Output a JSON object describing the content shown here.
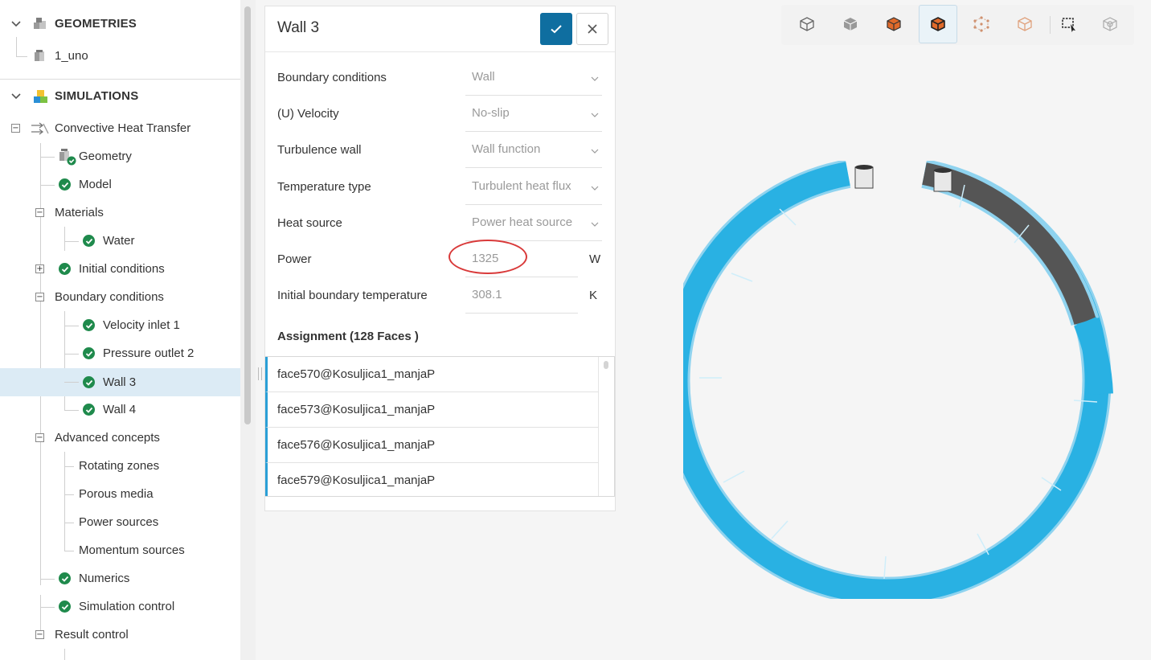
{
  "sidebar": {
    "geometries": {
      "label": "GEOMETRIES",
      "items": [
        {
          "label": "1_uno"
        }
      ]
    },
    "simulations": {
      "label": "SIMULATIONS",
      "simulation": {
        "label": "Convective Heat Transfer"
      },
      "items": {
        "geometry": "Geometry",
        "model": "Model",
        "materials": "Materials",
        "water": "Water",
        "initial_conditions": "Initial conditions",
        "boundary_conditions": "Boundary conditions",
        "velocity_inlet": "Velocity inlet 1",
        "pressure_outlet": "Pressure outlet 2",
        "wall3": "Wall 3",
        "wall4": "Wall 4",
        "advanced_concepts": "Advanced concepts",
        "rotating_zones": "Rotating zones",
        "porous_media": "Porous media",
        "power_sources": "Power sources",
        "momentum_sources": "Momentum sources",
        "numerics": "Numerics",
        "simulation_control": "Simulation control",
        "result_control": "Result control"
      }
    }
  },
  "panel": {
    "title": "Wall 3",
    "fields": [
      {
        "label": "Boundary conditions",
        "value": "Wall"
      },
      {
        "label": "(U) Velocity",
        "value": "No-slip"
      },
      {
        "label": "Turbulence wall",
        "value": "Wall function"
      },
      {
        "label": "Temperature type",
        "value": "Turbulent heat flux"
      },
      {
        "label": "Heat source",
        "value": "Power heat source"
      }
    ],
    "power": {
      "label": "Power",
      "value": "1325",
      "unit": "W"
    },
    "initial_temp": {
      "label": "Initial boundary temperature",
      "value": "308.1",
      "unit": "K"
    },
    "assignment": {
      "title": "Assignment (128 Faces )",
      "faces": [
        "face570@Kosuljica1_manjaP",
        "face573@Kosuljica1_manjaP",
        "face576@Kosuljica1_manjaP",
        "face579@Kosuljica1_manjaP"
      ]
    }
  },
  "colors": {
    "accent": "#0f6ea0",
    "check_green": "#1f8a4c",
    "selection": "#dcebf5",
    "face_blue": "#29b1e3",
    "face_dark": "#555555",
    "highlight_ring": "#d93a3a"
  }
}
